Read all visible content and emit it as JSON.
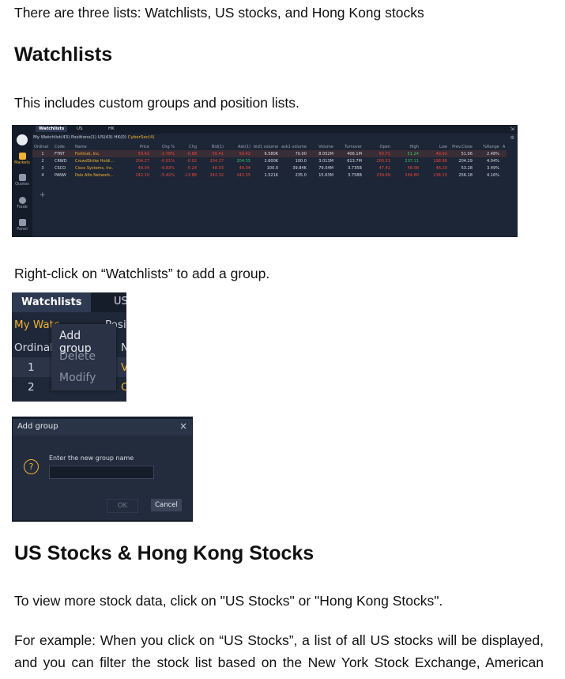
{
  "intro": "There are three lists: Watchlists, US stocks, and Hong Kong stocks",
  "h_watchlists": "Watchlists",
  "p_includes": "This includes custom groups and position lists.",
  "p_rightclick": "Right-click on “Watchlists” to add a group.",
  "h_us_hk": "US Stocks & Hong Kong Stocks",
  "p_view_more": "To view more stock data, click on \"US Stocks\" or \"Hong Kong Stocks\".",
  "p_example_line1": "For example: When you click on “US Stocks”, a list of all US stocks will be displayed,",
  "p_example_line2": "and you can filter the stock list based on the New York Stock Exchange, American",
  "ss1": {
    "tabs": [
      "Watchlists",
      "US",
      "HK"
    ],
    "sub_tabs": "My Watchlist(43)  Positions(1)  US(43)  HK(0)",
    "sub_active": "CyberSec(4)",
    "sidebar": [
      "Markets",
      "Quotes",
      "Trade",
      "Panel"
    ],
    "columns": [
      "Ordinal",
      "Code",
      "Name",
      "Price",
      "Chg %",
      "Chg",
      "Bid(1)",
      "Ask(1)",
      "bid1 volume",
      "ask1 volume",
      "Volume",
      "Turnover",
      "Open",
      "High",
      "Low",
      "Prev.Close",
      "%Range",
      "A"
    ],
    "rows": [
      [
        "1",
        "FTNT",
        "Fortinet, Inc.",
        "50.42",
        "-1.78%",
        "-0.88",
        "50.41",
        "50.42",
        "6.580K",
        "70.00",
        "8.052M",
        "406.1M",
        "50.71",
        "51.24",
        "49.92",
        "51.06",
        "2.48%"
      ],
      [
        "2",
        "CRWD",
        "CrowdStrike Holdi...",
        "204.27",
        "-0.01%",
        "-0.02",
        "204.27",
        "204.55",
        "2.600K",
        "100.0",
        "3.013M",
        "613.7M",
        "200.53",
        "207.11",
        "198.86",
        "204.29",
        "4.04%"
      ],
      [
        "3",
        "CSCO",
        "Cisco Systems, Inc.",
        "48.04",
        "-9.83%",
        "-5.24",
        "48.03",
        "48.04",
        "100.0",
        "39.84K",
        "79.04M",
        "3.735B",
        "47.41",
        "48.08",
        "46.20",
        "53.28",
        "3.49%"
      ],
      [
        "4",
        "PANW",
        "Palo Alto Network...",
        "242.10",
        "-5.42%",
        "-13.88",
        "242.32",
        "242.35",
        "1.521K",
        "235.0",
        "15.63M",
        "3.758B",
        "239.99",
        "244.80",
        "234.15",
        "256.18",
        "4.16%"
      ]
    ],
    "plus": "+"
  },
  "ss2": {
    "tab_watchlists": "Watchlists",
    "tab_us": "US",
    "my_watch": "My Watc",
    "posi": "Positic",
    "ordinal": "Ordinal",
    "na": "Na",
    "row1": "1",
    "row2": "2",
    "va": "Va",
    "co": "Co",
    "menu": [
      "Add group",
      "Delete",
      "Modify"
    ]
  },
  "ss3": {
    "title": "Add group",
    "close": "×",
    "prompt": "Enter the new group name",
    "ok": "OK",
    "cancel": "Cancel"
  }
}
